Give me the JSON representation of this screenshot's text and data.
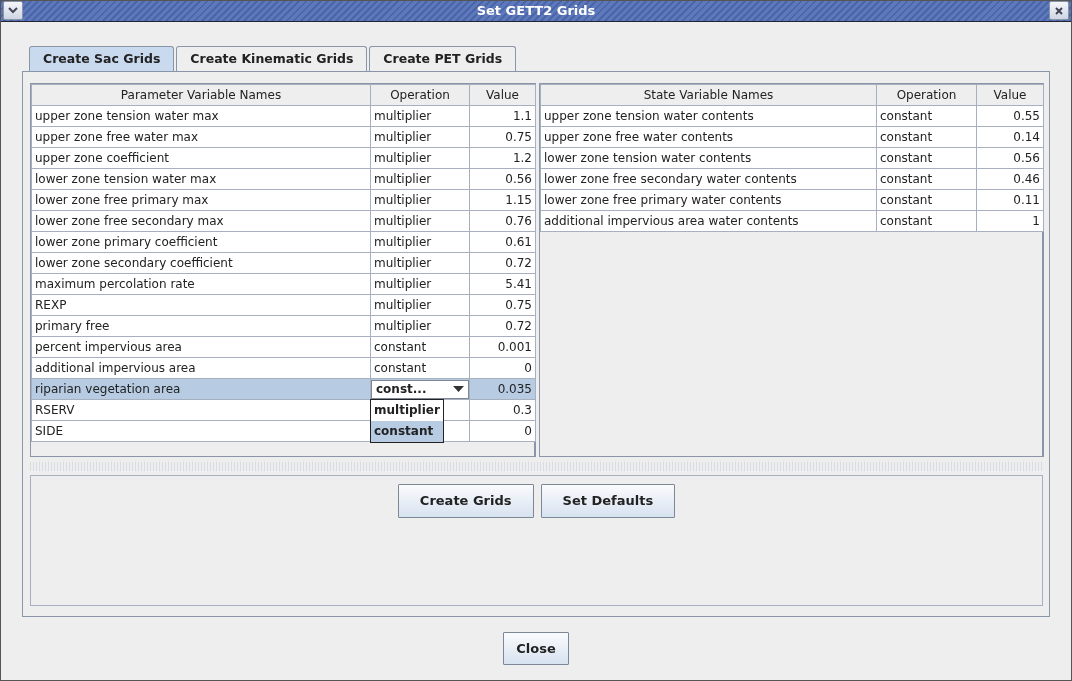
{
  "window": {
    "title": "Set GETT2 Grids"
  },
  "tabs": [
    {
      "label": "Create Sac Grids",
      "selected": true
    },
    {
      "label": "Create Kinematic Grids",
      "selected": false
    },
    {
      "label": "Create PET Grids",
      "selected": false
    }
  ],
  "parameter_table": {
    "columns": [
      "Parameter Variable Names",
      "Operation",
      "Value"
    ],
    "rows": [
      {
        "name": "upper zone tension water max",
        "operation": "multiplier",
        "value": "1.1",
        "selected": false
      },
      {
        "name": "upper zone free water max",
        "operation": "multiplier",
        "value": "0.75",
        "selected": false
      },
      {
        "name": "upper zone coefficient",
        "operation": "multiplier",
        "value": "1.2",
        "selected": false
      },
      {
        "name": "lower zone tension water max",
        "operation": "multiplier",
        "value": "0.56",
        "selected": false
      },
      {
        "name": "lower zone free primary max",
        "operation": "multiplier",
        "value": "1.15",
        "selected": false
      },
      {
        "name": "lower zone free secondary max",
        "operation": "multiplier",
        "value": "0.76",
        "selected": false
      },
      {
        "name": "lower zone primary coefficient",
        "operation": "multiplier",
        "value": "0.61",
        "selected": false
      },
      {
        "name": "lower zone secondary coefficient",
        "operation": "multiplier",
        "value": "0.72",
        "selected": false
      },
      {
        "name": "maximum percolation rate",
        "operation": "multiplier",
        "value": "5.41",
        "selected": false
      },
      {
        "name": "REXP",
        "operation": "multiplier",
        "value": "0.75",
        "selected": false
      },
      {
        "name": "primary free",
        "operation": "multiplier",
        "value": "0.72",
        "selected": false
      },
      {
        "name": "percent impervious area",
        "operation": "constant",
        "value": "0.001",
        "selected": false
      },
      {
        "name": "additional impervious area",
        "operation": "constant",
        "value": "0",
        "selected": false
      },
      {
        "name": "riparian vegetation area",
        "editor": {
          "text": "const...",
          "options": [
            {
              "label": "multiplier",
              "selected": false
            },
            {
              "label": "constant",
              "selected": true
            }
          ]
        },
        "value": "0.035",
        "selected": true
      },
      {
        "name": "RSERV",
        "value": "0.3",
        "selected": false
      },
      {
        "name": "SIDE",
        "value": "0",
        "selected": false
      }
    ]
  },
  "state_table": {
    "columns": [
      "State Variable Names",
      "Operation",
      "Value"
    ],
    "rows": [
      {
        "name": "upper zone tension water contents",
        "operation": "constant",
        "value": "0.55",
        "selected": false
      },
      {
        "name": "upper zone free water contents",
        "operation": "constant",
        "value": "0.14",
        "selected": false
      },
      {
        "name": "lower zone tension water contents",
        "operation": "constant",
        "value": "0.56",
        "selected": false
      },
      {
        "name": "lower zone free secondary water contents",
        "operation": "constant",
        "value": "0.46",
        "selected": false
      },
      {
        "name": "lower zone free primary water contents",
        "operation": "constant",
        "value": "0.11",
        "selected": false
      },
      {
        "name": "additional impervious area water contents",
        "operation": "constant",
        "value": "1",
        "selected": false
      }
    ]
  },
  "buttons": [
    "Create Grids",
    "Set Defaults"
  ],
  "close_button": "Close"
}
